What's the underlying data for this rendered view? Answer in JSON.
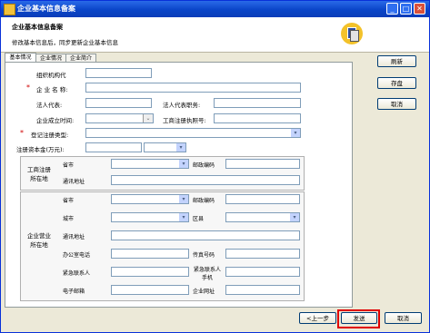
{
  "window": {
    "title": "企业基本信息备案"
  },
  "header": {
    "title": "企业基本信息备案",
    "subtitle": "修改基本信息后，同步更新企业基本信息"
  },
  "tabs": [
    "基本情况",
    "企业情况",
    "企业简介"
  ],
  "form": {
    "org_code": "组织机构代",
    "name": "企 业 名 称:",
    "legal_rep": "法人代表:",
    "legal_title": "法人代表职务:",
    "est_date": "企业成立时间:",
    "license_no": "工商注册执照号:",
    "reg_type": "登记注册类型:",
    "reg_capital": "注册资本金(万元):"
  },
  "group1": {
    "title": "工商注册所在地",
    "province": "省市",
    "postcode": "邮政编码",
    "address": "通讯地址"
  },
  "group2": {
    "title": "企业营业所在地",
    "province": "省市",
    "postcode": "邮政编码",
    "city": "城市",
    "district": "区县",
    "address": "通讯地址",
    "office_phone": "办公室电话",
    "fax": "传真号码",
    "contact": "紧急联系人",
    "contact_mobile": "紧急联系人手机",
    "email": "电子邮箱",
    "website": "企业网址"
  },
  "side_buttons": {
    "refresh": "刷新",
    "save": "存盘",
    "cancel": "取消"
  },
  "bottom_buttons": {
    "prev": "<上一步",
    "send": "发送",
    "cancel": "取消"
  }
}
